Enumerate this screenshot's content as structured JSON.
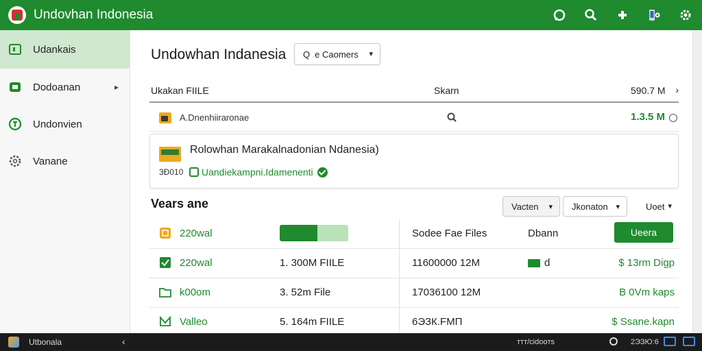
{
  "app": {
    "title": "Undovhan Indonesia"
  },
  "topbar": {
    "icons": [
      "chat-icon",
      "search-icon",
      "puzzle-icon",
      "device-icon",
      "gear-icon"
    ]
  },
  "sidebar": {
    "items": [
      {
        "label": "Udankais",
        "icon": "folder-icon",
        "active": true
      },
      {
        "label": "Dodoanan",
        "icon": "home-icon",
        "chevron": "▸"
      },
      {
        "label": "Undonvien",
        "icon": "info-icon"
      },
      {
        "label": "Vanane",
        "icon": "gear-icon"
      }
    ]
  },
  "main": {
    "title": "Undowhan Indanesia",
    "customer_select": {
      "icon": "Q",
      "label": "e Caomers"
    },
    "file_header": {
      "col1": "Ukakan FIILE",
      "col2": "Skarn",
      "col3": "590.7 M",
      "arrow": "›"
    },
    "file_row": {
      "name": "A.Dnenhiiraronae",
      "size": "1.3.5 M"
    },
    "detail_card": {
      "title": "Rolowhan Marakalnadonian Ndanesia)",
      "code": "3Ð010",
      "badge": "Uandiekampni.Idamenenti"
    },
    "section": {
      "title": "Vears ane",
      "filters": [
        {
          "label": "Vacten"
        },
        {
          "label": "Jkonaton"
        },
        {
          "label": "Uoet"
        }
      ]
    },
    "list": {
      "rows": [
        {
          "icon": "doc-icon",
          "name": "220wal",
          "progress": 0.55,
          "date": "Sodee Fae Files",
          "mark": "Dbann",
          "button": "Ueera"
        },
        {
          "icon": "check-icon",
          "name": "220wal",
          "size": "1. 300M FIILE",
          "date": "11600000 12M",
          "mark": "d",
          "right": "$ 13rm Digp"
        },
        {
          "icon": "folder-icon",
          "name": "k00om",
          "size": "3. 52m File",
          "date": "17036100 12M",
          "mark": "",
          "right": "В 0Vm kaps"
        },
        {
          "icon": "mail-icon",
          "name": "Valleo",
          "size": "5. 164m FIILE",
          "date": "6ЭЗК.FMП",
          "mark": "",
          "right": "$ Ssane.kapn"
        }
      ]
    }
  },
  "taskbar": {
    "label": "Utbonala",
    "back": "‹",
    "tray": "ттт/сidooтs",
    "clock": "2ЭЗЮ:6"
  },
  "colors": {
    "brand": "#1f8a2e",
    "sidebar_active": "#cfe8cf"
  }
}
